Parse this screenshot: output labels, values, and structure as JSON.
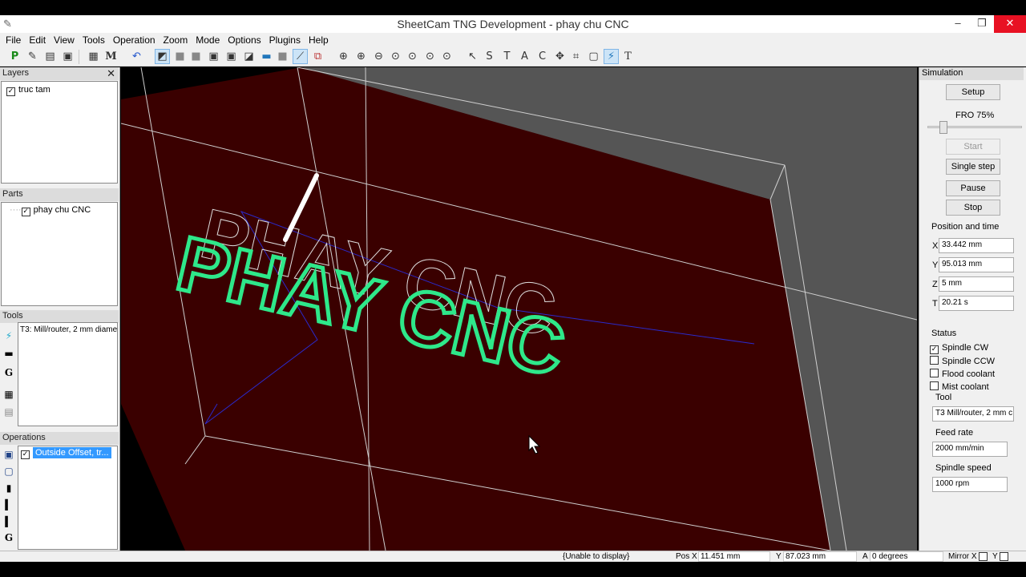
{
  "window": {
    "title": "SheetCam TNG Development - phay chu CNC"
  },
  "menu": [
    "File",
    "Edit",
    "View",
    "Tools",
    "Operation",
    "Zoom",
    "Mode",
    "Options",
    "Plugins",
    "Help"
  ],
  "layers": {
    "title": "Layers",
    "items": [
      {
        "label": "truc tam",
        "checked": true
      }
    ]
  },
  "parts": {
    "title": "Parts",
    "items": [
      {
        "label": "phay chu CNC",
        "checked": true
      }
    ]
  },
  "tools": {
    "title": "Tools",
    "items": [
      "T3: Mill/router, 2 mm diame"
    ]
  },
  "operations": {
    "title": "Operations",
    "items": [
      {
        "label": "Outside Offset, tr...",
        "checked": true
      }
    ]
  },
  "simulation": {
    "title": "Simulation",
    "setup": "Setup",
    "fro": "FRO 75%",
    "fro_value_percent": 75,
    "start": "Start",
    "single_step": "Single step",
    "pause": "Pause",
    "stop": "Stop",
    "position_title": "Position and time",
    "x_label": "X",
    "x_value": "33.442 mm",
    "y_label": "Y",
    "y_value": "95.013 mm",
    "z_label": "Z",
    "z_value": "5 mm",
    "t_label": "T",
    "t_value": "20.21 s",
    "status_title": "Status",
    "spindle_cw": "Spindle CW",
    "spindle_ccw": "Spindle CCW",
    "flood": "Flood coolant",
    "mist": "Mist coolant",
    "tool_title": "Tool",
    "tool_value": "T3 Mill/router, 2 mm c",
    "feed_title": "Feed rate",
    "feed_value": "2000 mm/min",
    "speed_title": "Spindle speed",
    "speed_value": "1000 rpm"
  },
  "statusbar": {
    "display": "{Unable to display}",
    "pos_label": "Pos X",
    "pos_x": "11.451 mm",
    "y_label": "Y",
    "pos_y": "87.023 mm",
    "a_label": "A",
    "a_value": "0 degrees",
    "mirror": "Mirror X",
    "mirror_y": "Y"
  },
  "viewport": {
    "text_green": "PHAY CNC",
    "colors": {
      "stock": "#3a0000",
      "toolpath": "#2ee88a",
      "rapid": "#2a2acc",
      "outline": "#dddddd"
    }
  }
}
